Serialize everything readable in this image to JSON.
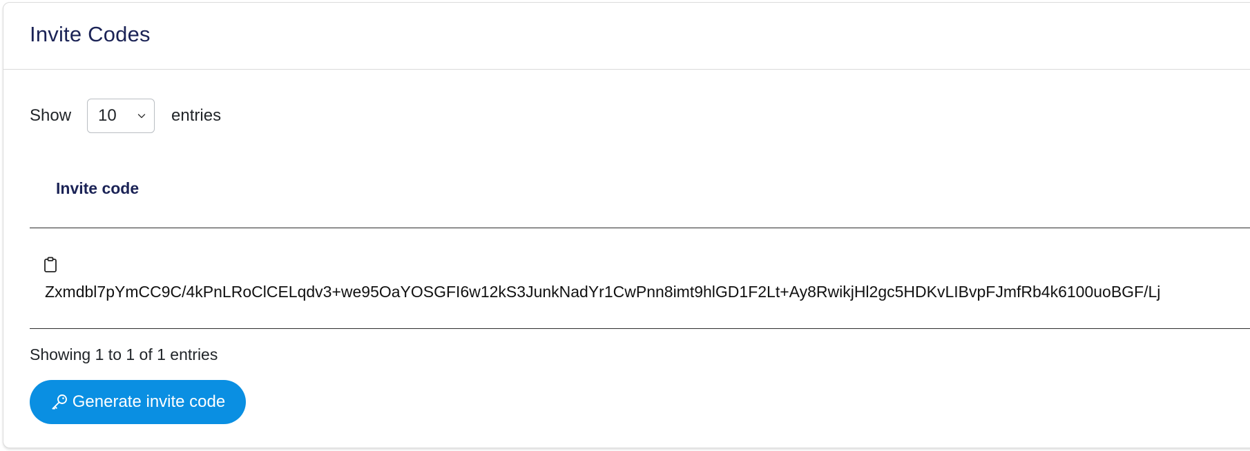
{
  "card": {
    "title": "Invite Codes"
  },
  "length_menu": {
    "show_label": "Show",
    "selected": "10",
    "entries_label": "entries",
    "chevron_icon": "chevron-down-icon"
  },
  "table": {
    "columns": [
      "Invite code"
    ],
    "rows": [
      {
        "copy_icon": "clipboard-icon",
        "code": "Zxmdbl7pYmCC9C/4kPnLRoClCELqdv3+we95OaYOSGFI6w12kS3JunkNadYr1CwPnn8imt9hlGD1F2Lt+Ay8RwikjHl2gc5HDKvLIBvpFJmfRb4k6100uoBGF/Lj"
      }
    ]
  },
  "info": "Showing 1 to 1 of 1 entries",
  "generate_button": {
    "icon": "key-icon",
    "label": "Generate invite code",
    "color": "#0a8fe2"
  },
  "colors": {
    "title": "#1b2356",
    "text": "#212529"
  }
}
